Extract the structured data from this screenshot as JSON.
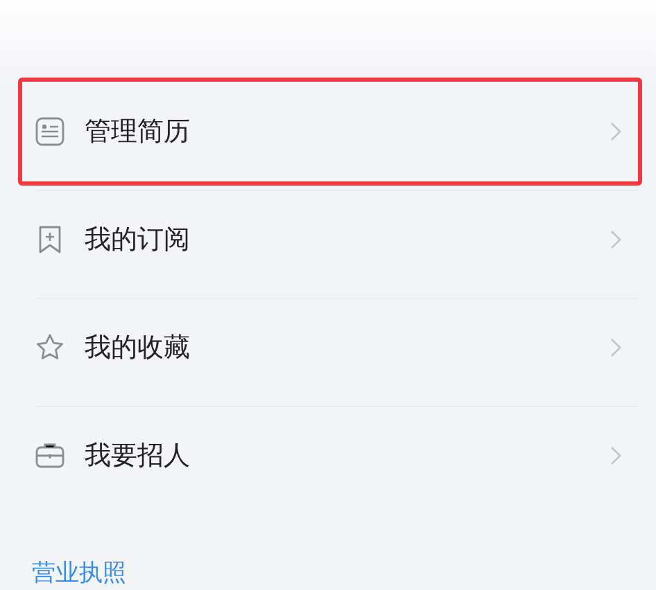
{
  "menu": [
    {
      "kind": "resume",
      "label": "管理简历",
      "selected": true
    },
    {
      "kind": "bookmark",
      "label": "我的订阅",
      "selected": false
    },
    {
      "kind": "star",
      "label": "我的收藏",
      "selected": false
    },
    {
      "kind": "briefcase",
      "label": "我要招人",
      "selected": false
    }
  ],
  "footer_link": "营业执照"
}
